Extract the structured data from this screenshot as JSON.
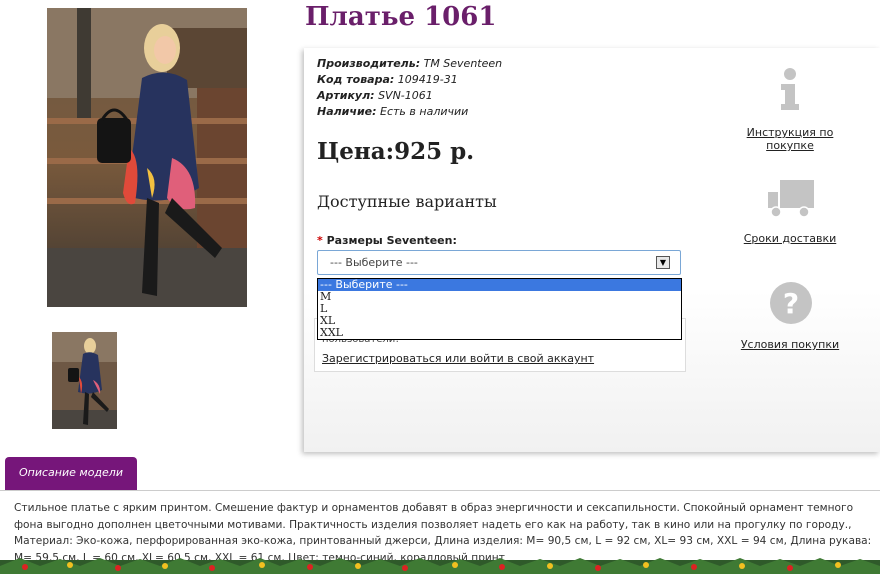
{
  "product": {
    "title": "Платье 1061",
    "manufacturer_label": "Производитель:",
    "manufacturer": "TM Seventeen",
    "code_label": "Код товара:",
    "code": "109419-31",
    "article_label": "Артикул:",
    "article": "SVN-1061",
    "stock_label": "Наличие:",
    "stock": "Есть в наличии",
    "price": "Цена:925 р."
  },
  "options": {
    "heading": "Доступные варианты",
    "required_mark": "*",
    "size_label": "Размеры Seventeen:",
    "select_value": "--- Выберите ---",
    "dropdown_options": [
      "--- Выберите ---",
      "M",
      "L",
      "XL",
      "XXL"
    ]
  },
  "login_box": {
    "partial_text": "пользователи!",
    "register_link": "Зарегистрироваться или войти в свой аккаунт"
  },
  "sidebar": {
    "items": [
      {
        "label": "Инструкция по покупке",
        "icon": "info-icon"
      },
      {
        "label": "Сроки доставки",
        "icon": "truck-icon"
      },
      {
        "label": "Условия покупки",
        "icon": "question-icon"
      }
    ]
  },
  "description": {
    "tab_label": "Описание модели",
    "text": "Стильное платье с ярким принтом. Смешение фактур и орнаментов добавят в образ энергичности и сексапильности. Спокойный орнамент темного фона выгодно дополнен цветочными мотивами. Практичность изделия позволяет надеть его как на работу, так в кино или на прогулку по городу., Материал: Эко-кожа, перфорированная эко-кожа, принтованный джерси, Длина изделия: M= 90,5 см, L = 92 см, XL= 93 см, XXL = 94 см, Длина рукава: M= 59,5 см, L = 60 см, XL= 60,5 см, XXL = 61 см, Цвет: темно-синий, коралловый принт"
  },
  "colors": {
    "title": "#6a1f6a",
    "tab": "#76167a",
    "select_highlight": "#3b78e0"
  }
}
